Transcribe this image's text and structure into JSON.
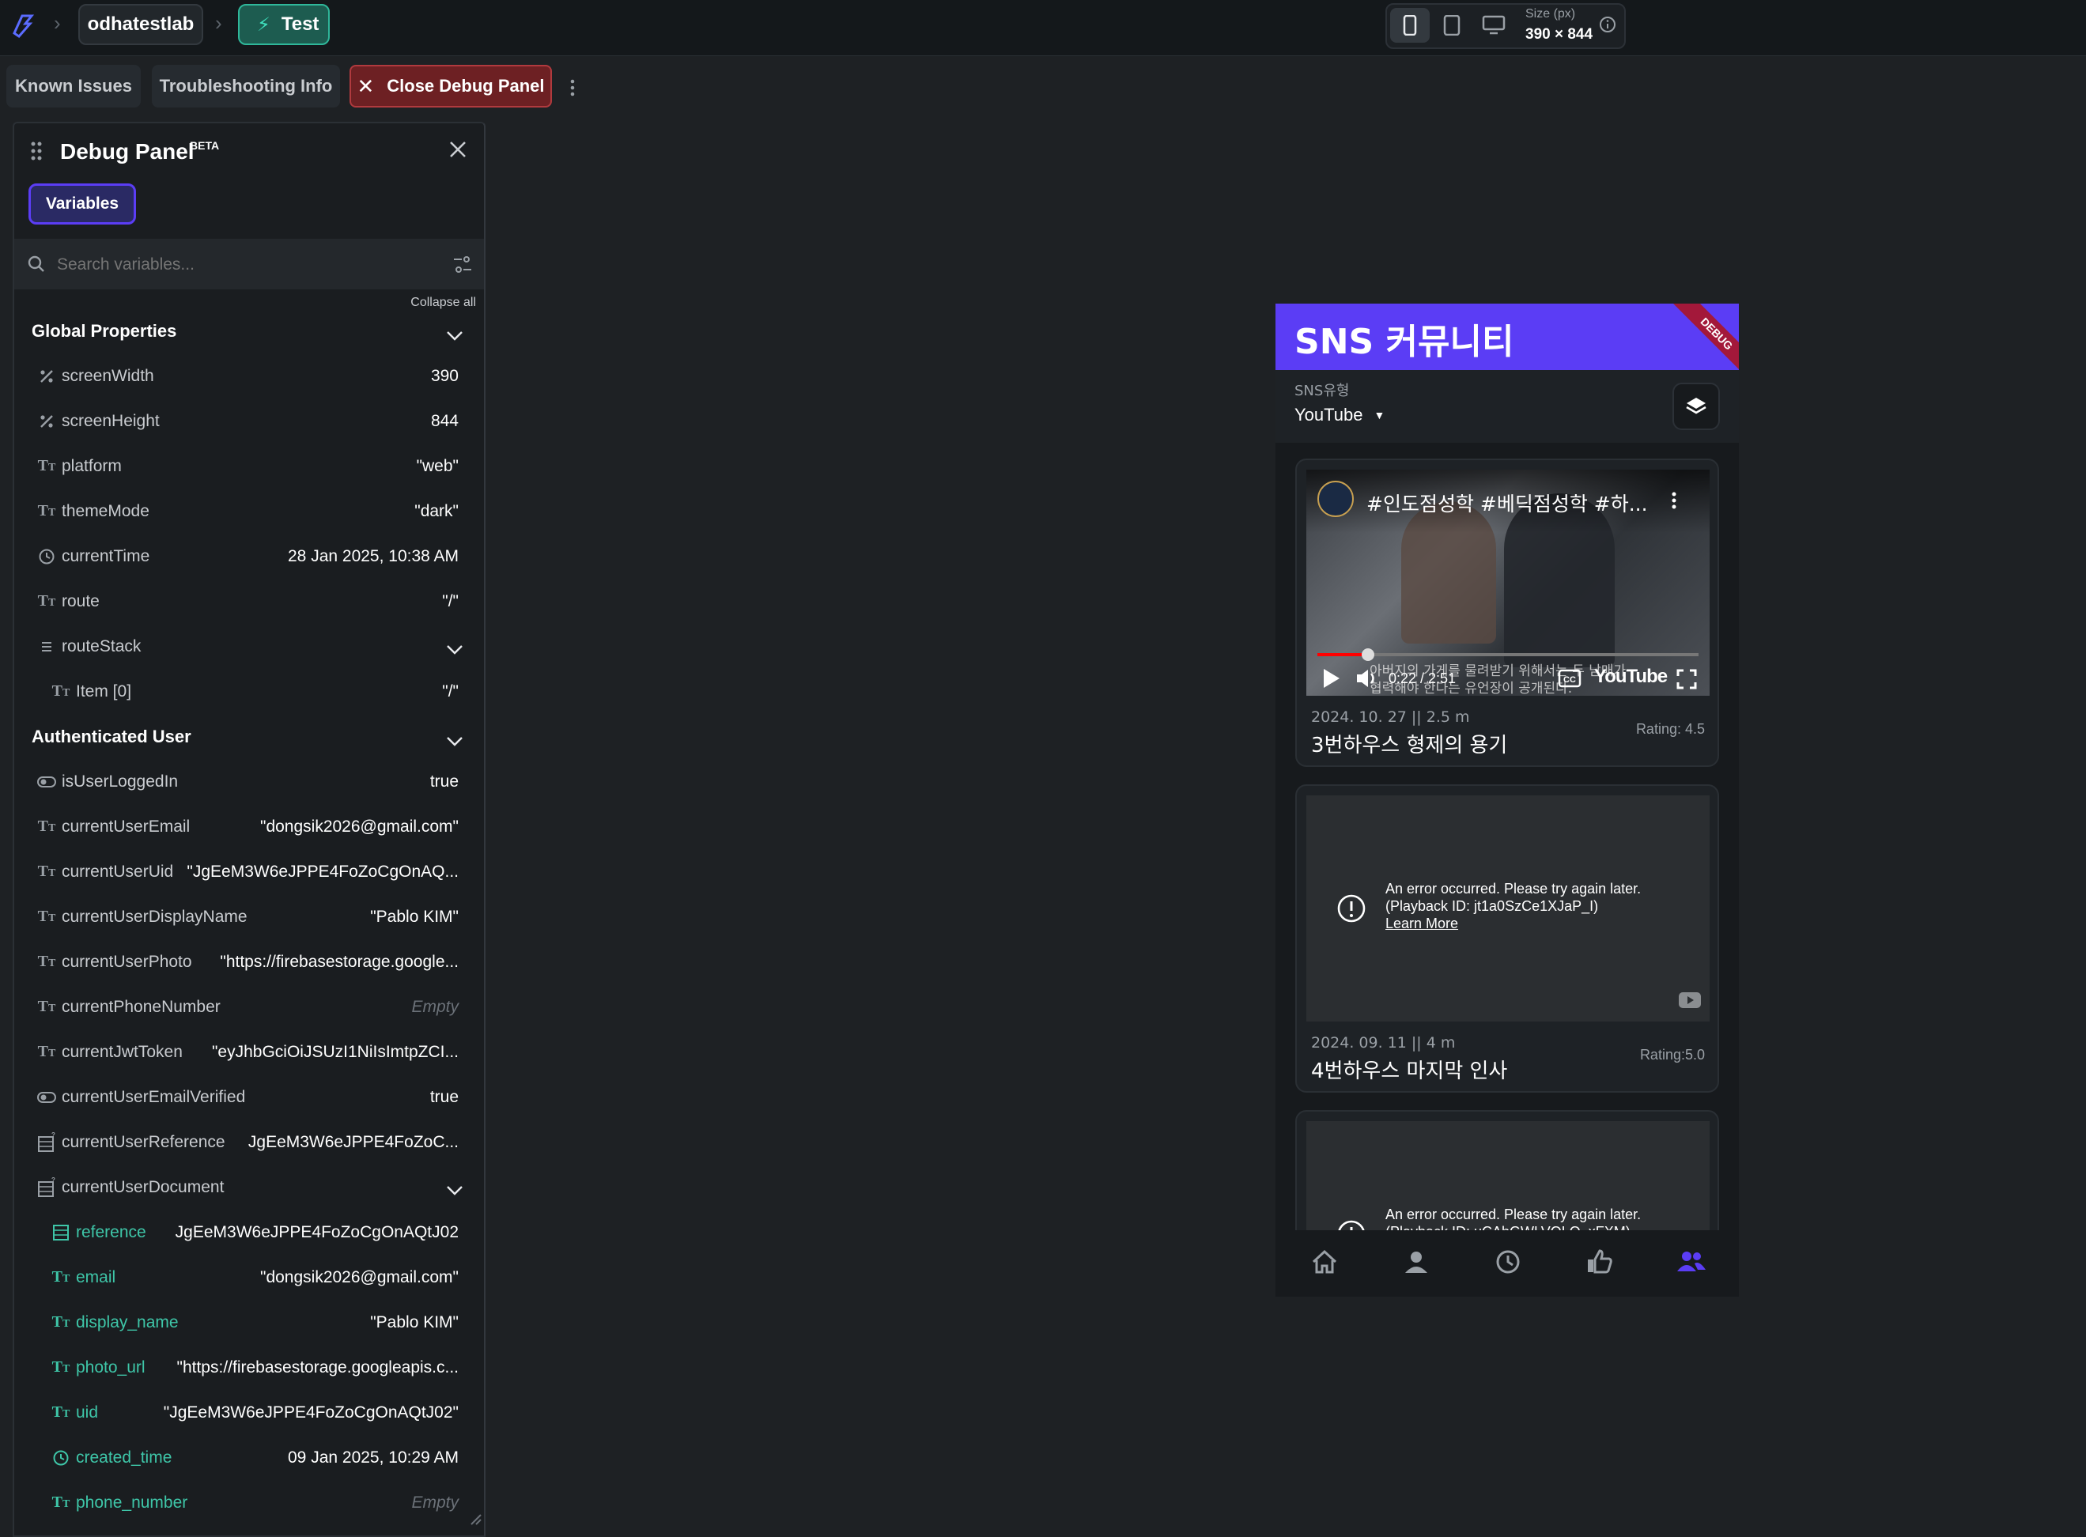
{
  "topbar": {
    "project_name": "odhatestlab",
    "test_label": "Test",
    "size_label": "Size (px)",
    "size_value": "390 × 844"
  },
  "toolbar": {
    "known_issues": "Known Issues",
    "troubleshooting": "Troubleshooting Info",
    "close_debug": "Close Debug Panel"
  },
  "panel": {
    "title": "Debug Panel",
    "badge": "BETA",
    "tab_variables": "Variables",
    "search_placeholder": "Search variables...",
    "collapse_all": "Collapse all",
    "global_title": "Global Properties",
    "auth_title": "Authenticated User",
    "global": [
      {
        "icon": "percent-icon",
        "name": "screenWidth",
        "value": "390"
      },
      {
        "icon": "percent-icon",
        "name": "screenHeight",
        "value": "844"
      },
      {
        "icon": "text-type-icon",
        "name": "platform",
        "value": "\"web\""
      },
      {
        "icon": "text-type-icon",
        "name": "themeMode",
        "value": "\"dark\""
      },
      {
        "icon": "clock-icon",
        "name": "currentTime",
        "value": "28 Jan 2025, 10:38 AM"
      },
      {
        "icon": "text-type-icon",
        "name": "route",
        "value": "\"/\""
      },
      {
        "icon": "list-icon",
        "name": "routeStack",
        "value": ""
      },
      {
        "icon": "text-type-icon",
        "name": "Item [0]",
        "value": "\"/\""
      }
    ],
    "auth": [
      {
        "icon": "toggle-icon",
        "name": "isUserLoggedIn",
        "value": "true"
      },
      {
        "icon": "text-type-icon",
        "name": "currentUserEmail",
        "value": "\"dongsik2026@gmail.com\""
      },
      {
        "icon": "text-type-icon",
        "name": "currentUserUid",
        "value": "\"JgEeM3W6eJPPE4FoZoCgOnAQ..."
      },
      {
        "icon": "text-type-icon",
        "name": "currentUserDisplayName",
        "value": "\"Pablo KIM\""
      },
      {
        "icon": "text-type-icon",
        "name": "currentUserPhoto",
        "value": "\"https://firebasestorage.google..."
      },
      {
        "icon": "text-type-icon",
        "name": "currentPhoneNumber",
        "value": "Empty"
      },
      {
        "icon": "text-type-icon",
        "name": "currentJwtToken",
        "value": "\"eyJhbGciOiJSUzI1NiIsImtpZCI..."
      },
      {
        "icon": "toggle-icon",
        "name": "currentUserEmailVerified",
        "value": "true"
      },
      {
        "icon": "document-ref-icon",
        "name": "currentUserReference",
        "value": "JgEeM3W6eJPPE4FoZoC..."
      },
      {
        "icon": "document-ref-icon",
        "name": "currentUserDocument",
        "value": ""
      },
      {
        "icon": "table-icon",
        "name": "reference",
        "value": "JgEeM3W6eJPPE4FoZoCgOnAQtJ02"
      },
      {
        "icon": "text-type-icon",
        "name": "email",
        "value": "\"dongsik2026@gmail.com\""
      },
      {
        "icon": "text-type-icon",
        "name": "display_name",
        "value": "\"Pablo KIM\""
      },
      {
        "icon": "text-type-icon",
        "name": "photo_url",
        "value": "\"https://firebasestorage.googleapis.c..."
      },
      {
        "icon": "text-type-icon",
        "name": "uid",
        "value": "\"JgEeM3W6eJPPE4FoZoCgOnAQtJ02\""
      },
      {
        "icon": "clock-icon",
        "name": "created_time",
        "value": "09 Jan 2025, 10:29 AM"
      },
      {
        "icon": "text-type-icon",
        "name": "phone_number",
        "value": "Empty"
      }
    ]
  },
  "phone": {
    "app_title": "SNS 커뮤니티",
    "debug_ribbon": "DEBUG",
    "dropdown_label": "SNS유형",
    "dropdown_value": "YouTube",
    "videos": [
      {
        "video_title": "#인도점성학 #베딕점성학 #하...",
        "subtitle_line1": "아버지의 가게를 물려받기 위해서는 두 남매가",
        "subtitle_line2": "협력해야 한다는 유언장이 공개된다.",
        "time": "0:22 / 2:51",
        "player_brand": "YouTube",
        "meta": "2024. 10. 27 || 2.5 m",
        "name": "3번하우스 형제의 용기",
        "rating": "Rating: 4.5"
      },
      {
        "error_line1": "An error occurred. Please try again later.",
        "error_line2": "(Playback ID: jt1a0SzCe1XJaP_I)",
        "learn_more": "Learn More",
        "meta": "2024. 09. 11 || 4 m",
        "name": "4번하우스 마지막 인사",
        "rating": "Rating:5.0"
      },
      {
        "error_line1": "An error occurred. Please try again later.",
        "error_line2": "(Playback ID: uCAhGWLVOLQ_xFXM)"
      }
    ]
  },
  "colors": {
    "accent": "#5b3df5",
    "test_green": "#2fb79a",
    "close_red": "#7a2426"
  }
}
